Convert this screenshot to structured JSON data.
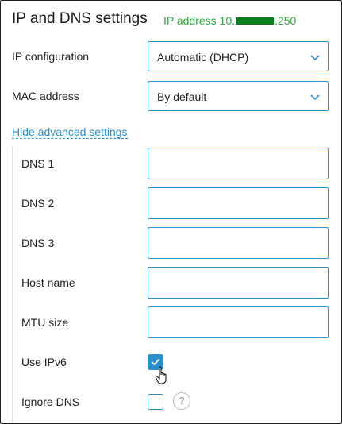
{
  "section": {
    "title": "IP and DNS settings",
    "ip_status_prefix": "IP address 10.",
    "ip_status_suffix": ".250"
  },
  "ip_config": {
    "label": "IP configuration",
    "value": "Automatic (DHCP)"
  },
  "mac": {
    "label": "MAC address",
    "value": "By default"
  },
  "advanced": {
    "toggle_label": "Hide advanced settings",
    "dns1_label": "DNS 1",
    "dns2_label": "DNS 2",
    "dns3_label": "DNS 3",
    "host_label": "Host name",
    "mtu_label": "MTU size",
    "ipv6_label": "Use IPv6",
    "ipv6_checked": true,
    "ignore_dns_label": "Ignore DNS",
    "ignore_dns_checked": false,
    "help_glyph": "?"
  },
  "colors": {
    "accent": "#2b8fcc",
    "status_green": "#2eaa3c"
  }
}
